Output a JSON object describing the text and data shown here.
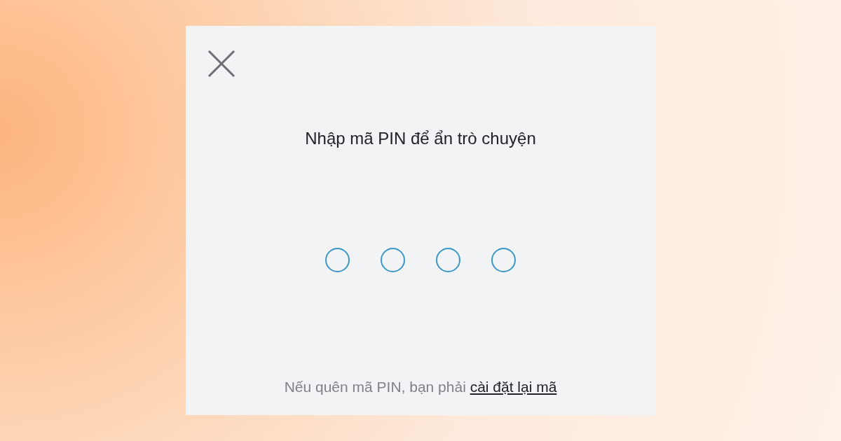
{
  "dialog": {
    "title": "Nhập mã PIN để ẩn trò chuyện",
    "pin_digits": [
      {
        "filled": false
      },
      {
        "filled": false
      },
      {
        "filled": false
      },
      {
        "filled": false
      }
    ],
    "footer": {
      "text": "Nếu quên mã PIN, bạn phải",
      "link": "cài đặt lại mã"
    }
  }
}
